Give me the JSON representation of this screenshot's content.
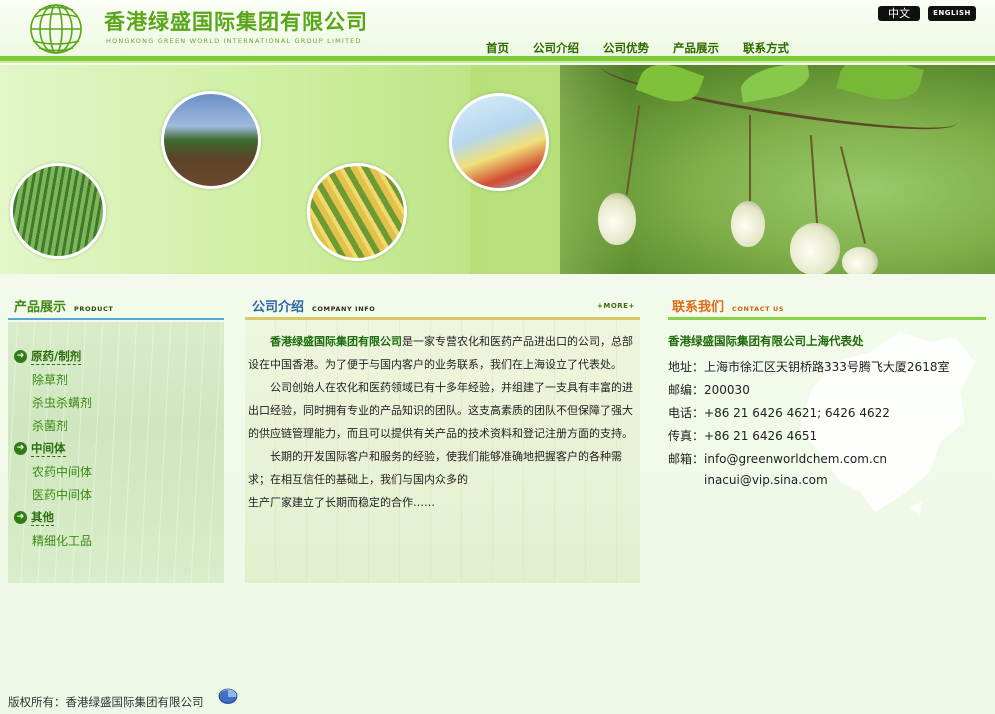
{
  "header": {
    "company_cn": "香港绿盛国际集团有限公司",
    "company_en": "HONGKONG GREEN WORLD INTERNATIONAL GROUP LIMITED",
    "lang_cn": "中文",
    "lang_en": "ENGLISH"
  },
  "nav": [
    {
      "label": "首页"
    },
    {
      "label": "公司介绍"
    },
    {
      "label": "公司优势"
    },
    {
      "label": "产品展示"
    },
    {
      "label": "联系方式"
    }
  ],
  "products": {
    "title_cn": "产品展示",
    "title_en": "PRODUCT",
    "categories": [
      {
        "label": "原药/制剂",
        "items": [
          "除草剂",
          "杀虫杀螨剂",
          "杀菌剂"
        ]
      },
      {
        "label": "中间体",
        "items": [
          "农药中间体",
          "医药中间体"
        ]
      },
      {
        "label": "其他",
        "items": [
          "精细化工品"
        ]
      }
    ]
  },
  "about": {
    "title_cn": "公司介绍",
    "title_en": "COMPANY INFO",
    "more": "+MORE+",
    "brand": "香港绿盛国际集团有限公司",
    "p1_rest": "是一家专营农化和医药产品进出口的公司，总部设在中国香港。为了便于与国内客户的业务联系，我们在上海设立了代表处。",
    "p2": "公司创始人在农化和医药领域已有十多年经验，并组建了一支具有丰富的进出口经验，同时拥有专业的产品知识的团队。这支高素质的团队不但保障了强大的供应链管理能力，而且可以提供有关产品的技术资料和登记注册方面的支持。",
    "p3a": "长期的开发国际客户和服务的经验，使我们能够准确地把握客户的各种需求；在相互信任的基础上，我们与国内众多的",
    "p3b": "生产厂家建立了长期而稳定的合作……"
  },
  "contact": {
    "title_cn": "联系我们",
    "title_en": "CONTACT US",
    "office": "香港绿盛国际集团有限公司上海代表处",
    "address_label": "地址：",
    "address": "上海市徐汇区天钥桥路333号腾飞大厦2618室",
    "zip_label": "邮编：",
    "zip": "200030",
    "tel_label": "电话：",
    "tel": "+86 21 6426 4621; 6426 4622",
    "fax_label": "传真：",
    "fax": "+86 21 6426 4651",
    "email_label": "邮箱：",
    "email1": "info@greenworldchem.com.cn",
    "email2": "inacui@vip.sina.com"
  },
  "footer": {
    "copyright": "版权所有：香港绿盛国际集团有限公司"
  },
  "colors": {
    "brand_green": "#5aa61a",
    "nav_green": "#2c6a00",
    "bar_green": "#7ccb3a",
    "about_blue": "#2c66a8",
    "contact_orange": "#e06a1c"
  }
}
